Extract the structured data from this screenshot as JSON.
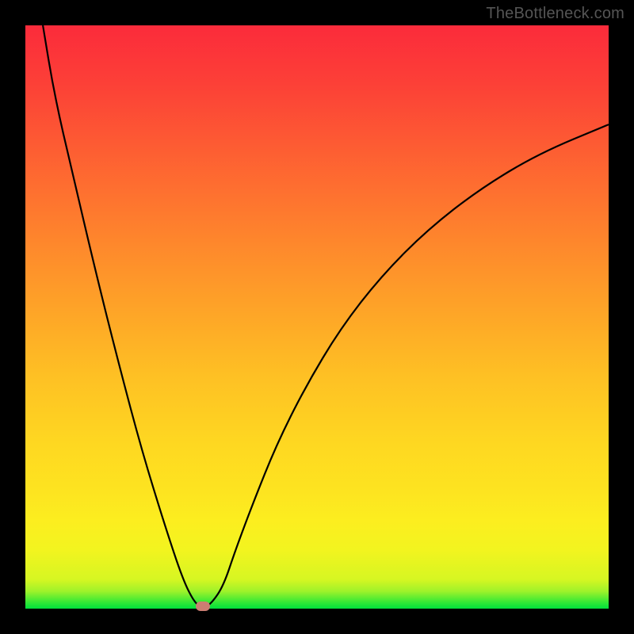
{
  "watermark": "TheBottleneck.com",
  "colors": {
    "background": "#000000",
    "gradient_top": "#fb2b3b",
    "gradient_mid_upper": "#fea727",
    "gradient_mid_lower": "#fcee1f",
    "gradient_bottom": "#00e13c",
    "curve": "#000000",
    "marker": "#cb7e72"
  },
  "chart_data": {
    "type": "line",
    "title": "",
    "xlabel": "",
    "ylabel": "",
    "xlim": [
      0,
      100
    ],
    "ylim": [
      0,
      100
    ],
    "legend": false,
    "grid": false,
    "series": [
      {
        "name": "bottleneck-curve",
        "x": [
          3,
          5,
          8,
          12,
          16,
          20,
          24,
          27,
          29,
          30.5,
          32,
          34,
          36,
          39,
          43,
          48,
          54,
          61,
          69,
          78,
          88,
          100
        ],
        "y": [
          100,
          88,
          75,
          58,
          42,
          27,
          14,
          5,
          1,
          0,
          1,
          4,
          10,
          18,
          28,
          38,
          48,
          57,
          65,
          72,
          78,
          83
        ]
      }
    ],
    "annotations": [
      {
        "name": "optimal-marker",
        "x": 30.5,
        "y": 0
      }
    ]
  }
}
